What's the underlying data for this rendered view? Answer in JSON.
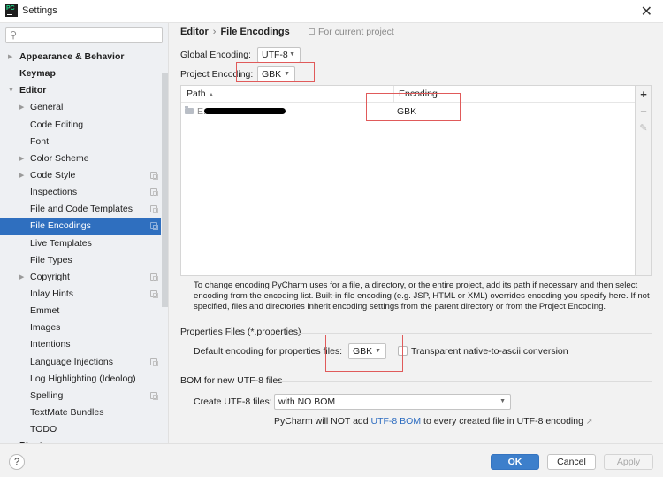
{
  "window": {
    "title": "Settings",
    "app_icon_text": "PC",
    "close_glyph": "✕"
  },
  "sidebar": {
    "search": {
      "value": "",
      "placeholder": ""
    },
    "items": [
      {
        "label": "Appearance & Behavior",
        "level": 0,
        "expandable": true,
        "expanded": false,
        "project_scope": false,
        "selected": false
      },
      {
        "label": "Keymap",
        "level": 0,
        "expandable": false,
        "project_scope": false,
        "selected": false
      },
      {
        "label": "Editor",
        "level": 0,
        "expandable": true,
        "expanded": true,
        "project_scope": false,
        "selected": false
      },
      {
        "label": "General",
        "level": 1,
        "expandable": true,
        "expanded": false,
        "project_scope": false,
        "selected": false
      },
      {
        "label": "Code Editing",
        "level": 1,
        "expandable": false,
        "project_scope": false,
        "selected": false
      },
      {
        "label": "Font",
        "level": 1,
        "expandable": false,
        "project_scope": false,
        "selected": false
      },
      {
        "label": "Color Scheme",
        "level": 1,
        "expandable": true,
        "expanded": false,
        "project_scope": false,
        "selected": false
      },
      {
        "label": "Code Style",
        "level": 1,
        "expandable": true,
        "expanded": false,
        "project_scope": true,
        "selected": false
      },
      {
        "label": "Inspections",
        "level": 1,
        "expandable": false,
        "project_scope": true,
        "selected": false
      },
      {
        "label": "File and Code Templates",
        "level": 1,
        "expandable": false,
        "project_scope": true,
        "selected": false
      },
      {
        "label": "File Encodings",
        "level": 1,
        "expandable": false,
        "project_scope": true,
        "selected": true
      },
      {
        "label": "Live Templates",
        "level": 1,
        "expandable": false,
        "project_scope": false,
        "selected": false
      },
      {
        "label": "File Types",
        "level": 1,
        "expandable": false,
        "project_scope": false,
        "selected": false
      },
      {
        "label": "Copyright",
        "level": 1,
        "expandable": true,
        "expanded": false,
        "project_scope": true,
        "selected": false
      },
      {
        "label": "Inlay Hints",
        "level": 1,
        "expandable": false,
        "project_scope": true,
        "selected": false
      },
      {
        "label": "Emmet",
        "level": 1,
        "expandable": false,
        "project_scope": false,
        "selected": false
      },
      {
        "label": "Images",
        "level": 1,
        "expandable": false,
        "project_scope": false,
        "selected": false
      },
      {
        "label": "Intentions",
        "level": 1,
        "expandable": false,
        "project_scope": false,
        "selected": false
      },
      {
        "label": "Language Injections",
        "level": 1,
        "expandable": false,
        "project_scope": true,
        "selected": false
      },
      {
        "label": "Log Highlighting (Ideolog)",
        "level": 1,
        "expandable": false,
        "project_scope": false,
        "selected": false
      },
      {
        "label": "Spelling",
        "level": 1,
        "expandable": false,
        "project_scope": true,
        "selected": false
      },
      {
        "label": "TextMate Bundles",
        "level": 1,
        "expandable": false,
        "project_scope": false,
        "selected": false
      },
      {
        "label": "TODO",
        "level": 1,
        "expandable": false,
        "project_scope": false,
        "selected": false
      },
      {
        "label": "Plugins",
        "level": 0,
        "expandable": false,
        "project_scope": false,
        "selected": false,
        "partially_visible": true
      }
    ]
  },
  "main": {
    "breadcrumb": {
      "parent": "Editor",
      "separator": "›",
      "current": "File Encodings"
    },
    "scope_note": "For current project",
    "global_encoding": {
      "label": "Global Encoding:",
      "value": "UTF-8"
    },
    "project_encoding": {
      "label": "Project Encoding:",
      "value": "GBK"
    },
    "table": {
      "columns": [
        {
          "label": "Path",
          "sort": "ascending",
          "sort_glyph": "▲"
        },
        {
          "label": "Encoding"
        }
      ],
      "rows": [
        {
          "path": "E:",
          "path_redacted": true,
          "encoding": "GBK"
        }
      ],
      "tools": {
        "add": "+",
        "remove": "−",
        "edit": "✎"
      }
    },
    "hint": "To change encoding PyCharm uses for a file, a directory, or the entire project, add its path if necessary and then select encoding from the encoding list. Built-in file encoding (e.g. JSP, HTML or XML) overrides encoding you specify here. If not specified, files and directories inherit encoding settings from the parent directory or from the Project Encoding.",
    "properties": {
      "title": "Properties Files (*.properties)",
      "default_label": "Default encoding for properties files:",
      "default_value": "GBK",
      "transparent_label": "Transparent native-to-ascii conversion",
      "transparent_checked": false
    },
    "bom": {
      "title": "BOM for new UTF-8 files",
      "create_label": "Create UTF-8 files:",
      "create_value": "with NO BOM",
      "note_prefix": "PyCharm will NOT add ",
      "note_link": "UTF-8 BOM",
      "note_suffix": " to every created file in UTF-8 encoding",
      "note_arrow": "↗"
    }
  },
  "footer": {
    "help": "?",
    "ok": "OK",
    "cancel": "Cancel",
    "apply": "Apply",
    "apply_enabled": false
  },
  "colors": {
    "accent": "#2f6fbf",
    "ok_button": "#3d7fcb",
    "link": "#2d6cc0",
    "annotation_red": "#e05a5a"
  }
}
